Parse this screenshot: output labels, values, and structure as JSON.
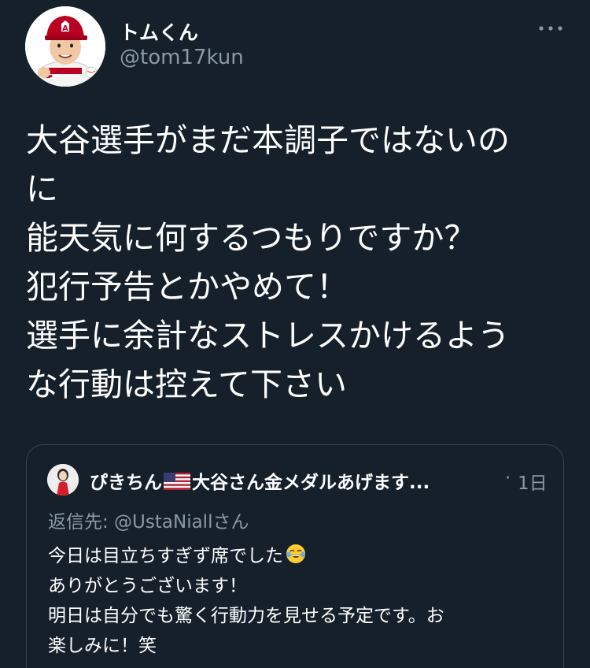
{
  "author": {
    "display_name": "トムくん",
    "handle": "@tom17kun",
    "avatar_icon": "angels-player-avatar-icon"
  },
  "more_icon": "more-horizontal-icon",
  "tweet_lines": [
    "大谷選手がまだ本調子ではないの",
    "に",
    "能天気に何するつもりですか？",
    "犯行予告とかやめて！",
    "選手に余計なストレスかけるよう",
    "な行動は控えて下さい"
  ],
  "quoted": {
    "name_part1": "ぴきちん",
    "flag_icon": "us-flag-icon",
    "name_part2": "大谷さん金メダルあげます...",
    "separator": "·",
    "time": "1日",
    "reply_to": "返信先: @UstaNiallさん",
    "lines": [
      "今日は目立ちすぎず席でした",
      "ありがとうございます！",
      "明日は自分でも驚く行動力を見せる予定です。お",
      "楽しみに！笑"
    ],
    "emoji_icon": "tears-of-joy-emoji-icon"
  },
  "colors": {
    "background": "#15202b",
    "text": "#ffffff",
    "secondary_text": "#8b98a5",
    "border": "#38444d"
  }
}
